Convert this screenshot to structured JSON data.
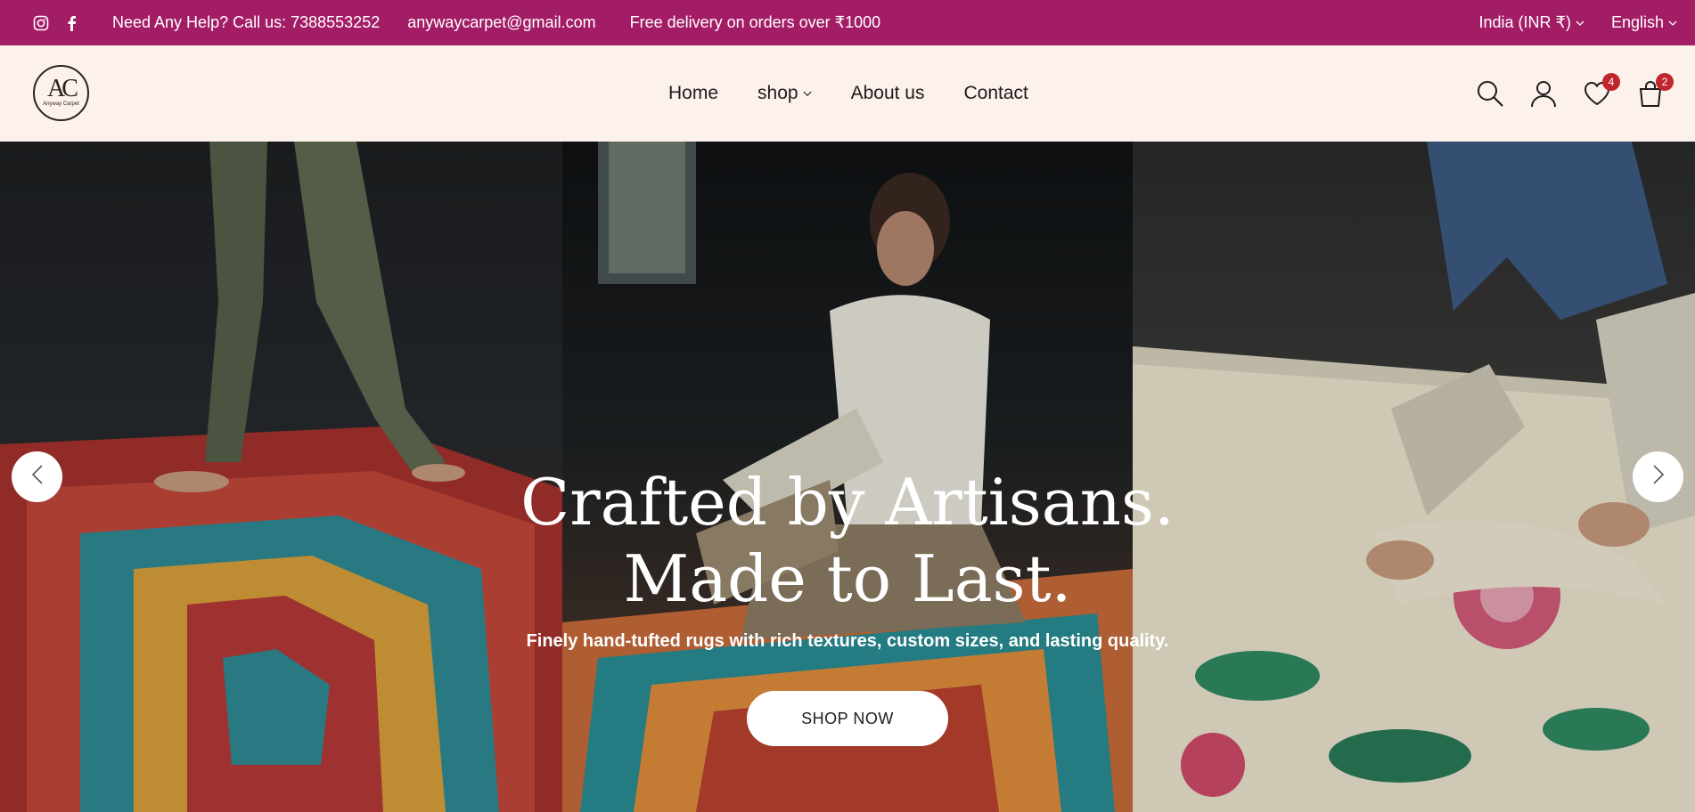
{
  "colors": {
    "topbar_bg": "#a31d66",
    "header_bg": "#fdf1eb",
    "badge_bg": "#c0262d"
  },
  "topbar": {
    "social_icons": [
      "instagram-icon",
      "facebook-icon"
    ],
    "help_text": "Need Any Help? Call us: 7388553252",
    "email": "anywaycarpet@gmail.com",
    "promo": "Free delivery on orders over ₹1000",
    "currency": "India (INR ₹)",
    "language": "English"
  },
  "header": {
    "logo_mono": "AC",
    "logo_sub": "Anyway Carpet",
    "nav": {
      "home": "Home",
      "shop": "shop",
      "about": "About us",
      "contact": "Contact"
    },
    "wishlist_count": "4",
    "cart_count": "2"
  },
  "hero": {
    "title_line1": "Crafted by Artisans.",
    "title_line2": "Made to Last.",
    "subtitle": "Finely hand-tufted rugs with rich textures, custom sizes, and lasting quality.",
    "cta": "SHOP NOW"
  }
}
